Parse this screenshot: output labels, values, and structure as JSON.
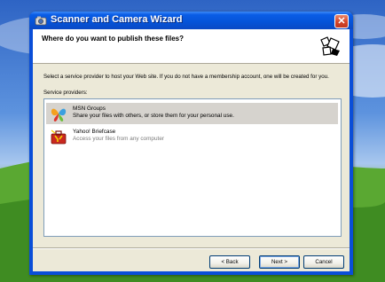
{
  "window": {
    "title": "Scanner and Camera Wizard",
    "close_glyph": "✕",
    "icon": "camera-wizard-icon"
  },
  "header": {
    "title": "Where do you want to publish these files?",
    "icon": "publish-web-icon"
  },
  "intro_text": "Select a service provider to host your Web site.  If you do not have a membership account, one will be created for you.",
  "service_providers_label": "Service providers:",
  "providers": [
    {
      "name": "MSN Groups",
      "description": "Share your files with others, or store them for your personal use.",
      "selected": true,
      "icon": "msn-butterfly-icon"
    },
    {
      "name": "Yahoo! Briefcase",
      "description": "Access your files from any computer",
      "selected": false,
      "icon": "yahoo-briefcase-icon"
    }
  ],
  "buttons": {
    "back": "< Back",
    "next": "Next >",
    "cancel": "Cancel"
  },
  "colors": {
    "titlebar": "#0553d8",
    "dialog_face": "#ece9d8",
    "selection": "#d6d3ce"
  }
}
